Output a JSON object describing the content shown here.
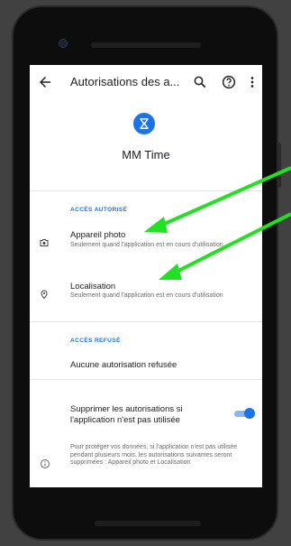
{
  "appbar": {
    "title": "Autorisations des a..."
  },
  "app": {
    "name": "MM Time",
    "accent": "#1a73e8"
  },
  "allowed": {
    "header": "ACCÈS AUTORISÉ",
    "items": [
      {
        "title": "Appareil photo",
        "subtitle": "Seulement quand l'application est en cours d'utilisation",
        "icon": "camera-icon"
      },
      {
        "title": "Localisation",
        "subtitle": "Seulement quand l'application est en cours d'utilisation",
        "icon": "location-icon"
      }
    ]
  },
  "denied": {
    "header": "ACCÈS REFUSÉ",
    "none_text": "Aucune autorisation refusée"
  },
  "auto_revoke": {
    "label": "Supprimer les autorisations si l'application n'est pas utilisée",
    "enabled": true
  },
  "info": {
    "text": "Pour protéger vos données, si l'application n'est pas utilisée pendant plusieurs mois, les autorisations suivantes seront supprimées : Appareil photo et Localisation"
  },
  "annotation": {
    "arrow_color": "#22e022"
  }
}
